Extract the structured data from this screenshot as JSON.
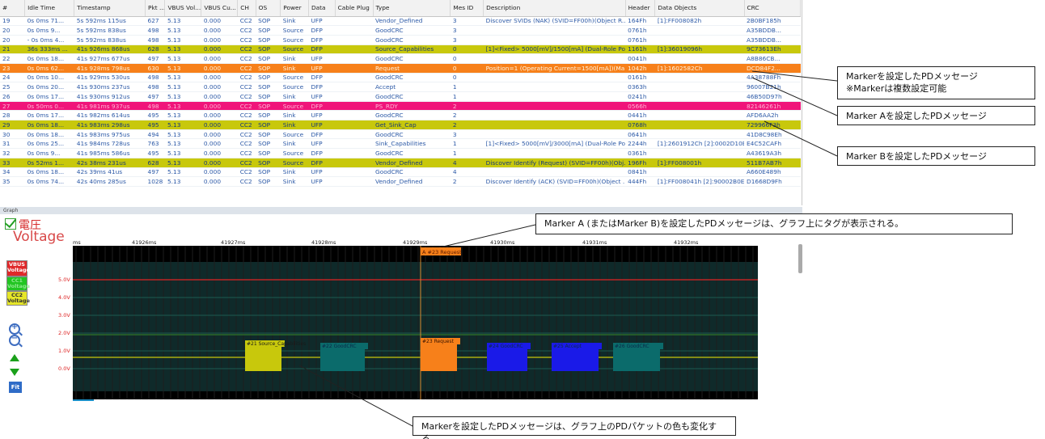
{
  "table": {
    "columns": [
      "#",
      "Idle Time",
      "Timestamp",
      "Pkt ...",
      "VBUS Vol...",
      "VBUS Cu...",
      "CH",
      "OS",
      "Power",
      "Data",
      "Cable Plug",
      "Type",
      "Mes ID",
      "Description",
      "Header",
      "Data Objects",
      "CRC"
    ],
    "rows": [
      {
        "cells": [
          "19",
          "0s  0ms 71...",
          "5s 592ms 115us",
          "627",
          "5.13",
          "0.000",
          "CC2",
          "SOP",
          "Sink",
          "UFP",
          "",
          "Vendor_Defined",
          "3",
          "Discover SVIDs (NAK) (SVID=FF00h)(Object R...",
          "164Fh",
          "[1]:FF008082h",
          "2B0BF185h"
        ],
        "style": "normal"
      },
      {
        "cells": [
          "20",
          "0s  0ms  9...",
          "5s 592ms 838us",
          "498",
          "5.13",
          "0.000",
          "CC2",
          "SOP",
          "Source",
          "DFP",
          "",
          "GoodCRC",
          "3",
          "",
          "0761h",
          "",
          "A35BDDB..."
        ],
        "style": "normal"
      },
      {
        "cells": [
          "20",
          "- 0s  0ms 4...",
          "5s 592ms 838us",
          "498",
          "5.13",
          "0.000",
          "CC2",
          "SOP",
          "Source",
          "DFP",
          "",
          "GoodCRC",
          "3",
          "",
          "0761h",
          "",
          "A35BDDB..."
        ],
        "style": "normal"
      },
      {
        "cells": [
          "21",
          "36s 333ms ...",
          "41s 926ms 868us",
          "628",
          "5.13",
          "0.000",
          "CC2",
          "SOP",
          "Source",
          "DFP",
          "",
          "Source_Capabilities",
          "0",
          "[1]<Fixed> 5000[mV]/1500[mA] (Dual-Role Po...",
          "1161h",
          "[1]:36019096h",
          "9C73613Eh"
        ],
        "style": "markerB"
      },
      {
        "cells": [
          "22",
          "0s  0ms 18...",
          "41s 927ms 677us",
          "497",
          "5.13",
          "0.000",
          "CC2",
          "SOP",
          "Sink",
          "UFP",
          "",
          "GoodCRC",
          "0",
          "",
          "0041h",
          "",
          "A8B86CB..."
        ],
        "style": "normal"
      },
      {
        "cells": [
          "23",
          "0s  0ms 62...",
          "41s 928ms 798us",
          "630",
          "5.13",
          "0.000",
          "CC2",
          "SOP",
          "Sink",
          "UFP",
          "",
          "Request",
          "0",
          "Position=1 (Operating Current=1500[mA])(Ma...",
          "1042h",
          "[1]:1602582Ch",
          "DCD84F2..."
        ],
        "style": "markerA"
      },
      {
        "cells": [
          "24",
          "0s  0ms 10...",
          "41s 929ms 530us",
          "498",
          "5.13",
          "0.000",
          "CC2",
          "SOP",
          "Source",
          "DFP",
          "",
          "GoodCRC",
          "0",
          "",
          "0161h",
          "",
          "4A38788Fh"
        ],
        "style": "normal"
      },
      {
        "cells": [
          "25",
          "0s  0ms 20...",
          "41s 930ms 237us",
          "498",
          "5.13",
          "0.000",
          "CC2",
          "SOP",
          "Source",
          "DFP",
          "",
          "Accept",
          "1",
          "",
          "0363h",
          "",
          "96007B21h"
        ],
        "style": "normal"
      },
      {
        "cells": [
          "26",
          "0s  0ms 17...",
          "41s 930ms 912us",
          "497",
          "5.13",
          "0.000",
          "CC2",
          "SOP",
          "Sink",
          "UFP",
          "",
          "GoodCRC",
          "1",
          "",
          "0241h",
          "",
          "46B50D97h"
        ],
        "style": "normal"
      },
      {
        "cells": [
          "27",
          "0s  50ms 0...",
          "41s 981ms 937us",
          "498",
          "5.13",
          "0.000",
          "CC2",
          "SOP",
          "Source",
          "DFP",
          "",
          "PS_RDY",
          "2",
          "",
          "0566h",
          "",
          "82146261h"
        ],
        "style": "markerM"
      },
      {
        "cells": [
          "28",
          "0s  0ms 17...",
          "41s 982ms 614us",
          "495",
          "5.13",
          "0.000",
          "CC2",
          "SOP",
          "Sink",
          "UFP",
          "",
          "GoodCRC",
          "2",
          "",
          "0441h",
          "",
          "AFD6AA2h"
        ],
        "style": "normal"
      },
      {
        "cells": [
          "29",
          "0s  0ms 18...",
          "41s 983ms 298us",
          "495",
          "5.13",
          "0.000",
          "CC2",
          "SOP",
          "Sink",
          "UFP",
          "",
          "Get_Sink_Cap",
          "2",
          "",
          "0768h",
          "",
          "729966F3h"
        ],
        "style": "markerB"
      },
      {
        "cells": [
          "30",
          "0s  0ms 18...",
          "41s 983ms 975us",
          "494",
          "5.13",
          "0.000",
          "CC2",
          "SOP",
          "Source",
          "DFP",
          "",
          "GoodCRC",
          "3",
          "",
          "0641h",
          "",
          "41D8C98Eh"
        ],
        "style": "normal"
      },
      {
        "cells": [
          "31",
          "0s  0ms 25...",
          "41s 984ms 728us",
          "763",
          "5.13",
          "0.000",
          "CC2",
          "SOP",
          "Sink",
          "UFP",
          "",
          "Sink_Capabilities",
          "1",
          "[1]<Fixed> 5000[mV]/3000[mA] (Dual-Role Po...",
          "2244h",
          "[1]:2601912Ch [2]:0002D10Eh",
          "E4C52CAFh"
        ],
        "style": "normal"
      },
      {
        "cells": [
          "32",
          "0s  0ms  9...",
          "41s 985ms 586us",
          "495",
          "5.13",
          "0.000",
          "CC2",
          "SOP",
          "Source",
          "DFP",
          "",
          "GoodCRC",
          "1",
          "",
          "0361h",
          "",
          "A43619A3h"
        ],
        "style": "normal"
      },
      {
        "cells": [
          "33",
          "0s  52ms 1...",
          "42s  38ms 231us",
          "628",
          "5.13",
          "0.000",
          "CC2",
          "SOP",
          "Source",
          "DFP",
          "",
          "Vendor_Defined",
          "4",
          "Discover Identify (Request) (SVID=FF00h)(Obj...",
          "196Fh",
          "[1]:FF008001h",
          "511B7AB7h"
        ],
        "style": "markerB"
      },
      {
        "cells": [
          "34",
          "0s  0ms 18...",
          "42s  39ms  41us",
          "497",
          "5.13",
          "0.000",
          "CC2",
          "SOP",
          "Sink",
          "UFP",
          "",
          "GoodCRC",
          "4",
          "",
          "0841h",
          "",
          "A660E489h"
        ],
        "style": "normal"
      },
      {
        "cells": [
          "35",
          "0s  0ms 74...",
          "42s  40ms 285us",
          "1028",
          "5.13",
          "0.000",
          "CC2",
          "SOP",
          "Sink",
          "UFP",
          "",
          "Vendor_Defined",
          "2",
          "Discover Identify (ACK) (SVID=FF00h)(Object ...",
          "444Fh",
          "[1]:FF008041h [2]:90002B0Eh...",
          "D1668D9Fh"
        ],
        "style": "normal"
      }
    ]
  },
  "graph": {
    "header": "Graph",
    "title_jp": "電圧",
    "title_en": "Voltage",
    "legend": [
      {
        "label": "VBUS Voltage",
        "color": "#e0282a"
      },
      {
        "label": "CC1 Voltage",
        "color": "#22c522"
      },
      {
        "label": "CC2 Voltage",
        "color": "#e6e628"
      }
    ],
    "tools": {
      "zoom_in": "zoom-in-icon",
      "zoom_out": "zoom-out-icon",
      "up": "up-arrow-icon",
      "down": "down-arrow-icon",
      "fit": "Fit"
    },
    "time_ticks": [
      "ms",
      "41926ms",
      "41927ms",
      "41928ms",
      "41929ms",
      "41930ms",
      "41931ms",
      "41932ms"
    ],
    "y_labels": [
      "5.0V",
      "4.0V",
      "3.0V",
      "2.0V",
      "1.0V",
      "0.0V"
    ],
    "tag": "A #23 Request",
    "packets": [
      {
        "label": "#21 Source_Capabilities",
        "color": "#c8c80c"
      },
      {
        "label": "#22 GoodCRC",
        "color": "#0b6b6b"
      },
      {
        "label": "#23 Request",
        "color": "#f7801a"
      },
      {
        "label": "#24 GoodCRC",
        "color": "#1a1ae8"
      },
      {
        "label": "#25 Accept",
        "color": "#1a1ae8"
      },
      {
        "label": "#26 GoodCRC",
        "color": "#0b6b6b"
      }
    ]
  },
  "annotations": {
    "marker": [
      "Markerを設定したPDメッセージ",
      "※Markerは複数設定可能"
    ],
    "marker_a": "Marker Aを設定したPDメッセージ",
    "marker_b": "Marker Bを設定したPDメッセージ",
    "graph_tag": "Marker A (またはMarker B)を設定したPDメッセージは、グラフ上にタグが表示される。",
    "packet_color": "Markerを設定したPDメッセージは、グラフ上のPDパケットの色も変化する。"
  }
}
